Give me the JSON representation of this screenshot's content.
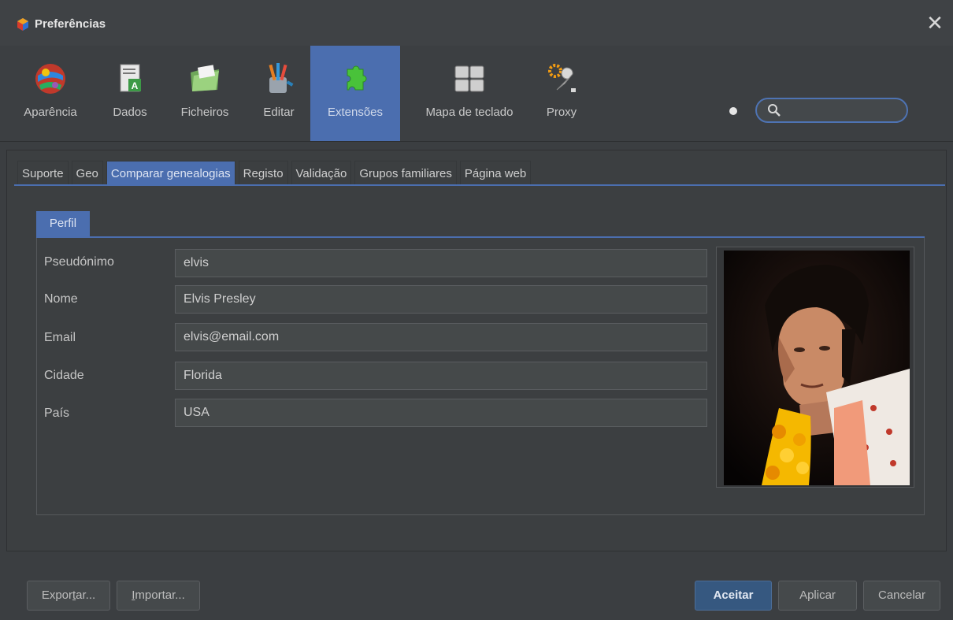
{
  "window": {
    "title": "Preferências",
    "close_symbol": "✕"
  },
  "toolbar": {
    "items": [
      {
        "label": "Aparência",
        "icon": "appearance-globe-icon"
      },
      {
        "label": "Dados",
        "icon": "data-document-icon"
      },
      {
        "label": "Ficheiros",
        "icon": "folder-icon"
      },
      {
        "label": "Editar",
        "icon": "pencil-cup-icon"
      },
      {
        "label": "Extensões",
        "icon": "puzzle-piece-icon",
        "active": true
      },
      {
        "label": "Mapa de teclado",
        "icon": "keyboard-keys-icon"
      },
      {
        "label": "Proxy",
        "icon": "wrench-gear-icon"
      }
    ],
    "search": {
      "value": ""
    }
  },
  "tabs": [
    {
      "label": "Suporte"
    },
    {
      "label": "Geo"
    },
    {
      "label": "Comparar genealogias",
      "active": true
    },
    {
      "label": "Registo"
    },
    {
      "label": "Validação"
    },
    {
      "label": "Grupos familiares"
    },
    {
      "label": "Página web"
    }
  ],
  "subtab": {
    "label": "Perfil"
  },
  "profile": {
    "fields": [
      {
        "label": "Pseudónimo",
        "value": "elvis"
      },
      {
        "label": "Nome",
        "value": "Elvis Presley"
      },
      {
        "label": "Email",
        "value": "elvis@email.com"
      },
      {
        "label": "Cidade",
        "value": "Florida"
      },
      {
        "label": "País",
        "value": "USA"
      }
    ]
  },
  "buttons": {
    "export": {
      "label_pre": "Expor",
      "label_u": "t",
      "label_post": "ar..."
    },
    "import": {
      "label_u": "I",
      "label_post": "mportar..."
    },
    "accept": "Aceitar",
    "apply": "Aplicar",
    "cancel": "Cancelar"
  },
  "colors": {
    "accent": "#4b6eaf",
    "background": "#3c3f41",
    "primary_button": "#365880"
  }
}
